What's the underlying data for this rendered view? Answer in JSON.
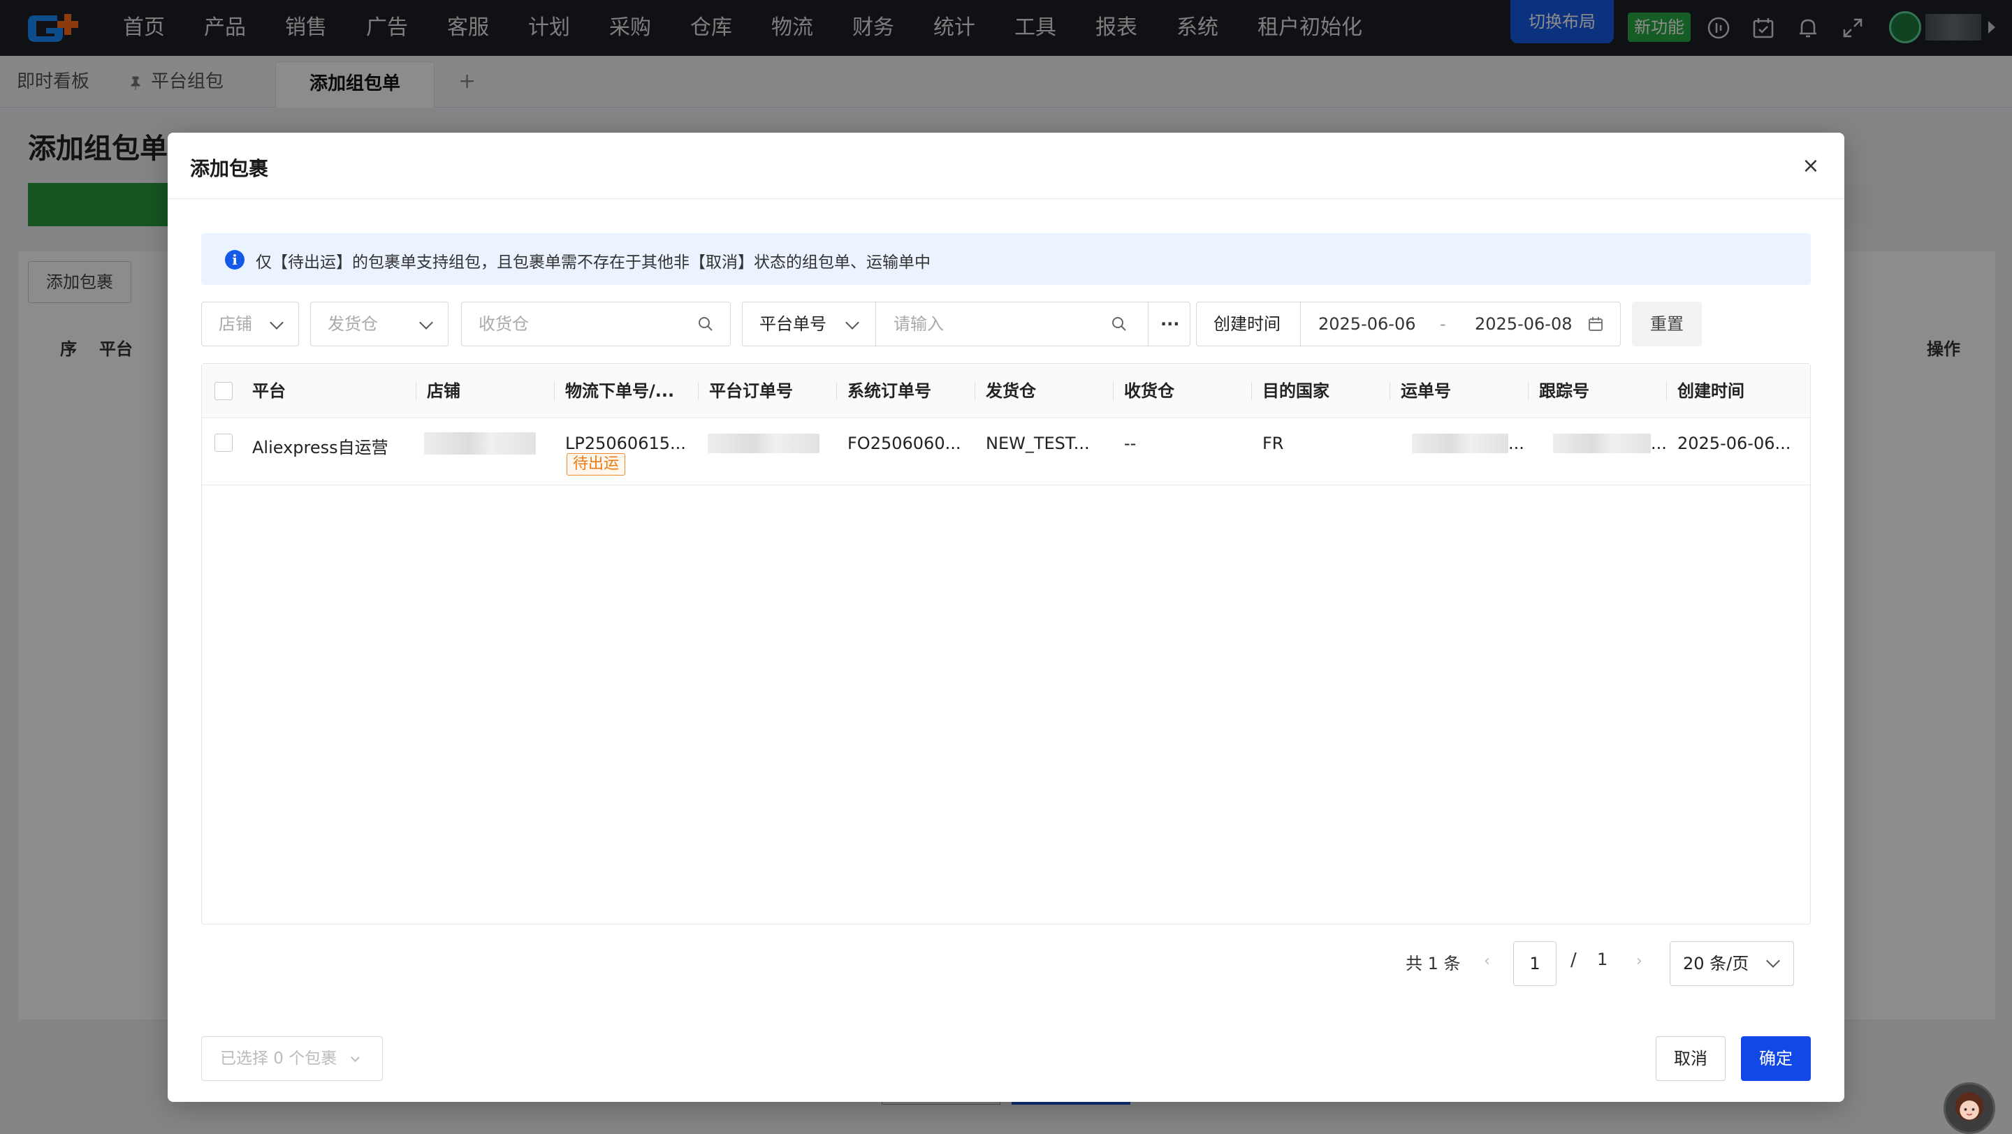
{
  "nav": {
    "items": [
      "首页",
      "产品",
      "销售",
      "广告",
      "客服",
      "计划",
      "采购",
      "仓库",
      "物流",
      "财务",
      "统计",
      "工具",
      "报表",
      "系统",
      "租户初始化"
    ],
    "layout_btn": "切换布局",
    "new_feature_btn": "新功能"
  },
  "tabs": {
    "items": [
      "即时看板",
      "平台组包",
      "添加组包单"
    ],
    "add": "+"
  },
  "background": {
    "page_title": "添加组包单",
    "add_package_btn": "添加包裹",
    "col_seq": "序",
    "col_platform": "平台",
    "col_action": "操作"
  },
  "modal": {
    "title": "添加包裹",
    "close": "×",
    "notice": "仅【待出运】的包裹单支持组包，且包裹单需不存在于其他非【取消】状态的组包单、运输单中",
    "filters": {
      "shop_placeholder": "店铺",
      "ship_wh_placeholder": "发货仓",
      "recv_wh_placeholder": "收货仓",
      "order_type": "平台单号",
      "order_input_placeholder": "请输入",
      "more": "···",
      "date_label": "创建时间",
      "date_from": "2025-06-06",
      "date_sep": "-",
      "date_to": "2025-06-08",
      "reset": "重置"
    },
    "table": {
      "headers": [
        "平台",
        "店铺",
        "物流下单号/...",
        "平台订单号",
        "系统订单号",
        "发货仓",
        "收货仓",
        "目的国家",
        "运单号",
        "跟踪号",
        "创建时间"
      ],
      "rows": [
        {
          "platform": "Aliexpress自运营",
          "logistics_no": "LP25060615...",
          "status": "待出运",
          "system_order_no": "FO2506060...",
          "ship_wh": "NEW_TEST...",
          "recv_wh": "--",
          "country": "FR",
          "waybill_suffix": "...",
          "tracking_suffix": "...",
          "created": "2025-06-06..."
        }
      ]
    },
    "pagination": {
      "total": "共 1 条",
      "prev": "‹",
      "page": "1",
      "sep": "/",
      "pages": "1",
      "next": "›",
      "page_size": "20 条/页"
    },
    "footer": {
      "selected": "已选择 0 个包裹",
      "cancel": "取消",
      "ok": "确定"
    }
  },
  "colors": {
    "accent": "#1148e6",
    "status_orange": "#f07a10",
    "nav_bg": "#1c1f26",
    "new_green": "#27a844"
  }
}
